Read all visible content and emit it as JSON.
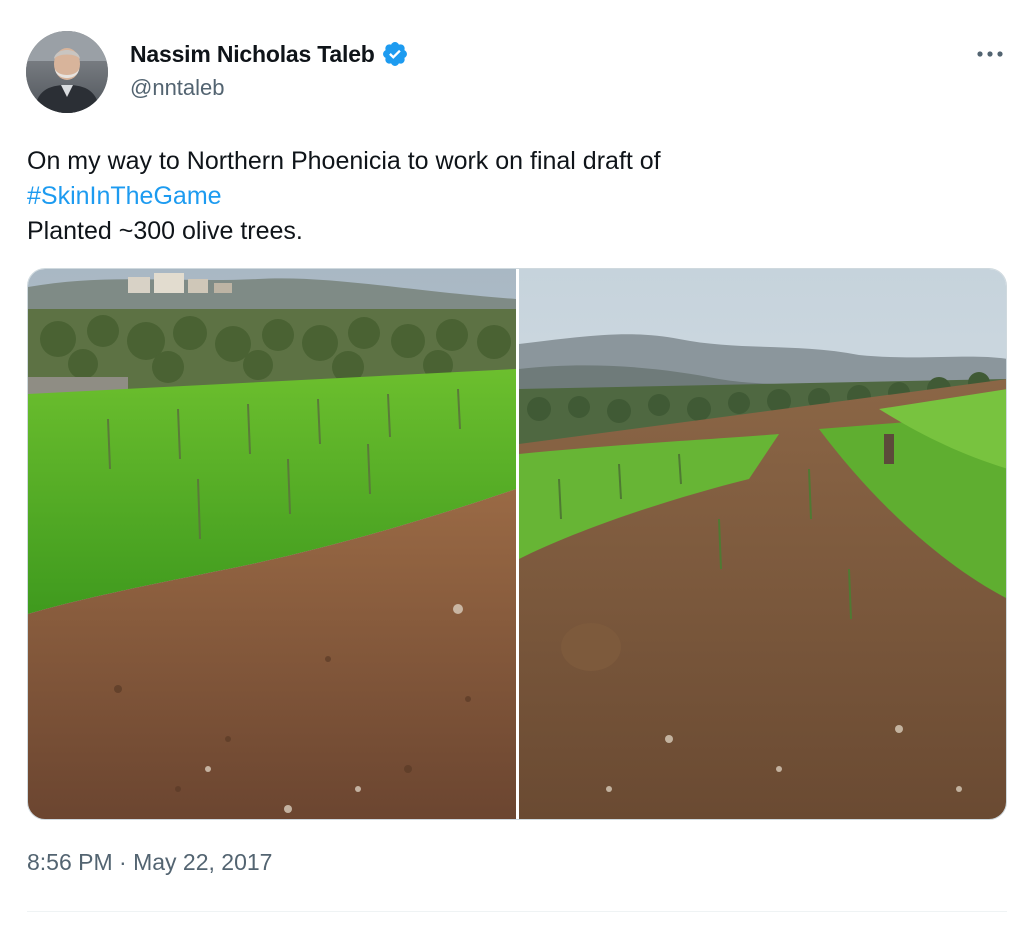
{
  "author": {
    "display_name": "Nassim Nicholas Taleb",
    "handle": "@nntaleb",
    "verified": true,
    "avatar_icon": "user-avatar"
  },
  "tweet": {
    "line1": "On my way to Northern Phoenicia to work on final draft of",
    "hashtag": "#SkinInTheGame",
    "line3": "Planted ~300 olive trees.",
    "timestamp": "8:56 PM · May 22, 2017"
  },
  "media": {
    "photo_count": 2,
    "photos": [
      {
        "icon": "olive-field-photo-1"
      },
      {
        "icon": "olive-field-photo-2"
      }
    ]
  },
  "colors": {
    "text": "#0f1419",
    "secondary": "#536471",
    "accent": "#1d9bf0",
    "border": "#cfd9de"
  },
  "icons": {
    "verified": "verified-badge-icon",
    "more": "more-options-icon"
  }
}
